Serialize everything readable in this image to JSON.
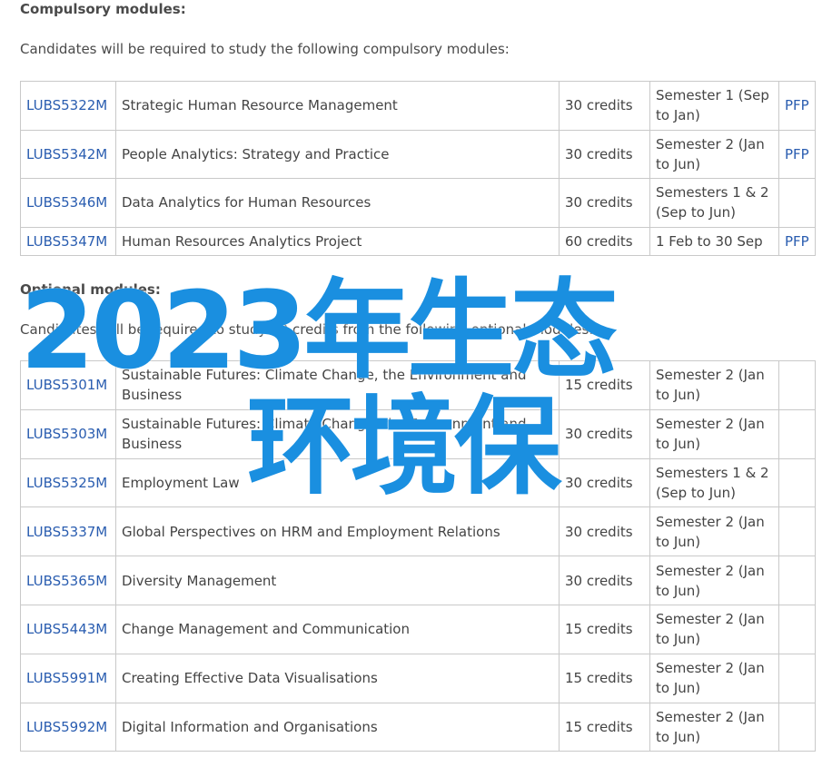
{
  "compulsory": {
    "heading": "Compulsory modules:",
    "intro": "Candidates will be required to study the following compulsory modules:",
    "rows": [
      {
        "code": "LUBS5322M",
        "title": "Strategic Human Resource Management",
        "credits": "30 credits",
        "semester": "Semester 1 (Sep to Jan)",
        "pfp": "PFP"
      },
      {
        "code": "LUBS5342M",
        "title": "People Analytics: Strategy and Practice",
        "credits": "30 credits",
        "semester": "Semester 2 (Jan to Jun)",
        "pfp": "PFP"
      },
      {
        "code": "LUBS5346M",
        "title": "Data Analytics for Human Resources",
        "credits": "30 credits",
        "semester": "Semesters 1 & 2 (Sep to Jun)",
        "pfp": ""
      },
      {
        "code": "LUBS5347M",
        "title": "Human Resources Analytics Project",
        "credits": "60 credits",
        "semester": "1 Feb to 30 Sep",
        "pfp": "PFP"
      }
    ]
  },
  "optional": {
    "heading": "Optional modules:",
    "intro": "Candidates will be required to study 30 credits from the following optional modules:",
    "rows": [
      {
        "code": "LUBS5301M",
        "title": "Sustainable Futures: Climate Change, the Environment and Business",
        "credits": "15 credits",
        "semester": "Semester 2 (Jan to Jun)",
        "pfp": ""
      },
      {
        "code": "LUBS5303M",
        "title": "Sustainable Futures: Climate Change, the Environment and Business",
        "credits": "30 credits",
        "semester": "Semester 2 (Jan to Jun)",
        "pfp": ""
      },
      {
        "code": "LUBS5325M",
        "title": "Employment Law",
        "credits": "30 credits",
        "semester": "Semesters 1 & 2 (Sep to Jun)",
        "pfp": ""
      },
      {
        "code": "LUBS5337M",
        "title": "Global Perspectives on HRM and Employment Relations",
        "credits": "30 credits",
        "semester": "Semester 2 (Jan to Jun)",
        "pfp": ""
      },
      {
        "code": "LUBS5365M",
        "title": "Diversity Management",
        "credits": "30 credits",
        "semester": "Semester 2 (Jan to Jun)",
        "pfp": ""
      },
      {
        "code": "LUBS5443M",
        "title": "Change Management and Communication",
        "credits": "15 credits",
        "semester": "Semester 2 (Jan to Jun)",
        "pfp": ""
      },
      {
        "code": "LUBS5991M",
        "title": "Creating Effective Data Visualisations",
        "credits": "15 credits",
        "semester": "Semester 2 (Jan to Jun)",
        "pfp": ""
      },
      {
        "code": "LUBS5992M",
        "title": "Digital Information and Organisations",
        "credits": "15 credits",
        "semester": "Semester 2 (Jan to Jun)",
        "pfp": ""
      }
    ]
  },
  "watermark": {
    "line1": "2023年生态",
    "line2": "环境保"
  },
  "colors": {
    "link": "#2a5db0",
    "watermark": "#1a8fe0",
    "border": "#c9c9c9"
  }
}
